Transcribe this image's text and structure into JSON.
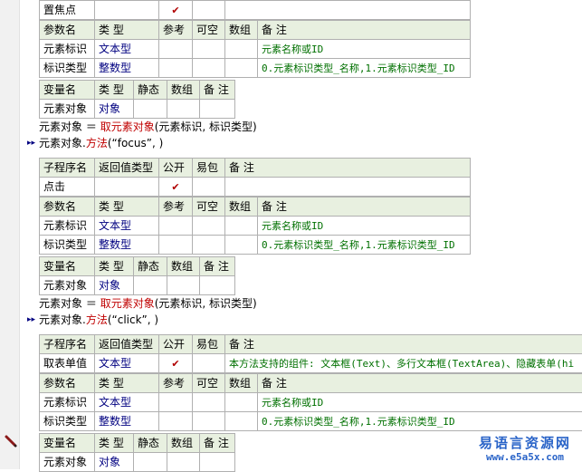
{
  "sub_header": {
    "name": "子程序名",
    "return_type": "返回值类型",
    "public": "公开",
    "easy_pkg": "易包",
    "remark": "备 注"
  },
  "param_header": {
    "name": "参数名",
    "type": "类 型",
    "ref": "参考",
    "nullable": "可空",
    "array": "数组",
    "remark": "备 注"
  },
  "var_header": {
    "name": "变量名",
    "type": "类 型",
    "static": "静态",
    "array": "数组",
    "remark": "备 注"
  },
  "params": {
    "p1": {
      "name": "元素标识",
      "type": "文本型",
      "remark": "元素名称或ID"
    },
    "p2": {
      "name": "标识类型",
      "type": "整数型",
      "remark": "0.元素标识类型_名称,1.元素标识类型_ID"
    }
  },
  "var": {
    "name": "元素对象",
    "type": "对象"
  },
  "checkmark": "✔",
  "block0": {
    "sub_name": "置焦点"
  },
  "block1": {
    "sub_name": "点击"
  },
  "block2": {
    "sub_name": "取表单值",
    "return_type": "文本型",
    "remark": "本方法支持的组件: 文本框(Text)、多行文本框(TextArea)、隐藏表单(hi"
  },
  "code": {
    "assign": {
      "target": "元素对象",
      "op": "＝",
      "func": "取元素对象",
      "args": "(元素标识, 标识类型)"
    },
    "call_focus": {
      "obj": "元素对象.",
      "method": "方法",
      "args": "(“focus”, )"
    },
    "call_click": {
      "obj": "元素对象.",
      "method": "方法",
      "args": "(“click”, )"
    }
  },
  "gutter_arrow": "▸▸",
  "watermark": {
    "line1": "易语言资源网",
    "line2": "www.e5a5x.com"
  }
}
